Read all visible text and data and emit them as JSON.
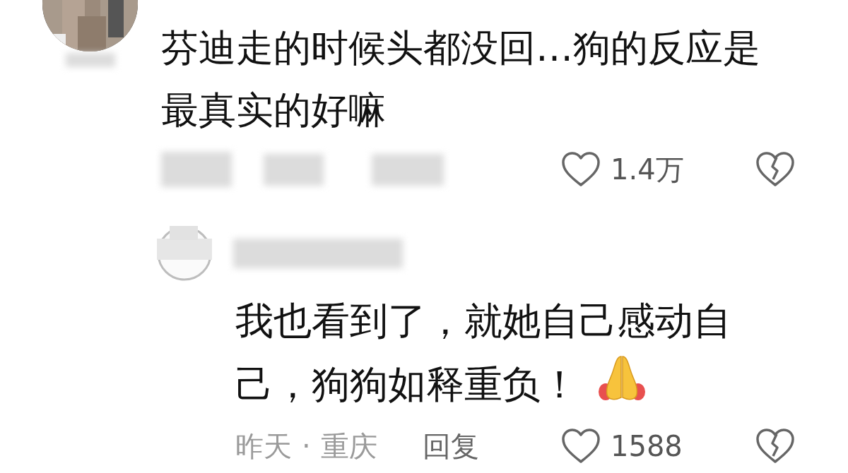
{
  "comment": {
    "text": "芬迪走的时候头都没回…狗的反应是最真实的好嘛",
    "likes": "1.4万",
    "reply": {
      "text": "我也看到了，就她自己感动自己，狗狗如释重负！",
      "emoji": true,
      "time": "昨天",
      "separator": "·",
      "location": "重庆",
      "reply_label": "回复",
      "likes": "1588"
    }
  }
}
